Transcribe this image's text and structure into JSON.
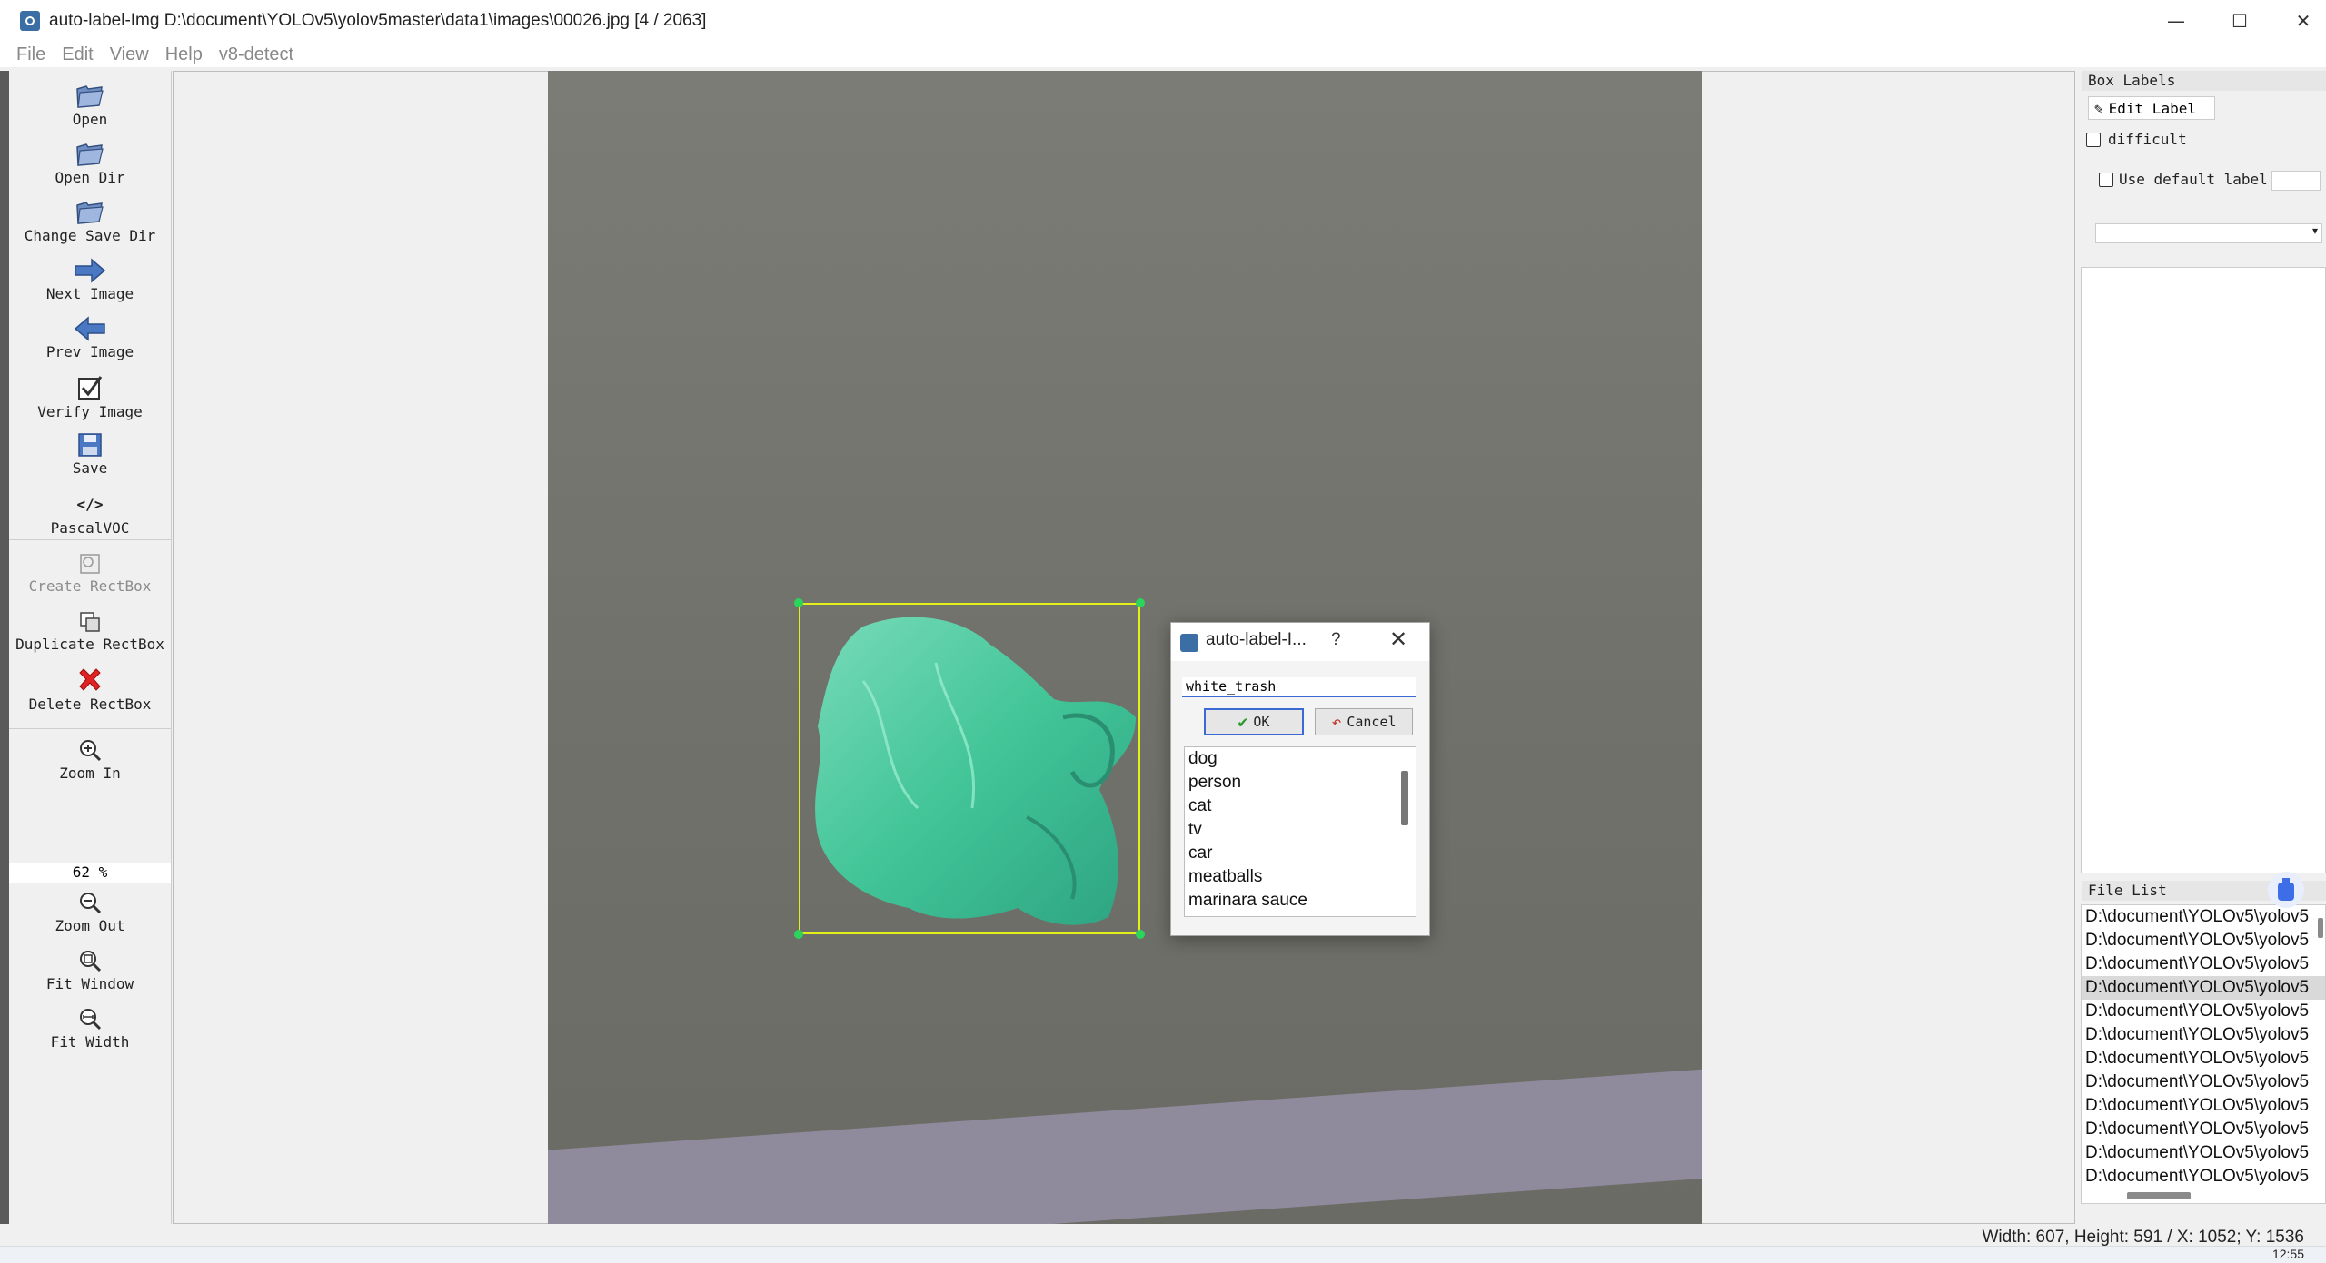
{
  "window": {
    "title": "auto-label-Img D:\\document\\YOLOv5\\yolov5master\\data1\\images\\00026.jpg [4 / 2063]",
    "minimize": "—",
    "maximize": "☐",
    "close": "✕"
  },
  "menu": [
    "File",
    "Edit",
    "View",
    "Help",
    "v8-detect"
  ],
  "toolbar": {
    "open": "Open",
    "open_dir": "Open Dir",
    "change_save_dir": "Change Save Dir",
    "next_image": "Next Image",
    "prev_image": "Prev Image",
    "verify_image": "Verify Image",
    "save": "Save",
    "format_icon": "</>",
    "format": "PascalVOC",
    "create_rectbox": "Create RectBox",
    "duplicate_rectbox": "Duplicate RectBox",
    "delete_rectbox": "Delete RectBox",
    "zoom_in": "Zoom In",
    "zoom_value": "62 %",
    "zoom_out": "Zoom Out",
    "fit_window": "Fit Window",
    "fit_width": "Fit Width"
  },
  "dialog": {
    "title": "auto-label-I...",
    "help": "?",
    "close": "✕",
    "input_value": "white_trash",
    "ok": "OK",
    "cancel": "Cancel",
    "labels": [
      "dog",
      "person",
      "cat",
      "tv",
      "car",
      "meatballs",
      "marinara sauce"
    ]
  },
  "right_panel": {
    "box_labels_title": "Box Labels",
    "edit_label": "Edit Label",
    "difficult": "difficult",
    "use_default_label": "Use default label",
    "file_list_title": "File List",
    "files": [
      "D:\\document\\YOLOv5\\yolov5",
      "D:\\document\\YOLOv5\\yolov5",
      "D:\\document\\YOLOv5\\yolov5",
      "D:\\document\\YOLOv5\\yolov5",
      "D:\\document\\YOLOv5\\yolov5",
      "D:\\document\\YOLOv5\\yolov5",
      "D:\\document\\YOLOv5\\yolov5",
      "D:\\document\\YOLOv5\\yolov5",
      "D:\\document\\YOLOv5\\yolov5",
      "D:\\document\\YOLOv5\\yolov5",
      "D:\\document\\YOLOv5\\yolov5",
      "D:\\document\\YOLOv5\\yolov5"
    ],
    "selected_file_index": 3
  },
  "status": {
    "text": "Width: 607, Height: 591 / X: 1052; Y: 1536"
  },
  "taskbar": {
    "clock": "12:55"
  },
  "colors": {
    "bbox": "#e3ef17",
    "handle": "#2bd45a",
    "accent": "#3b6bd2"
  }
}
